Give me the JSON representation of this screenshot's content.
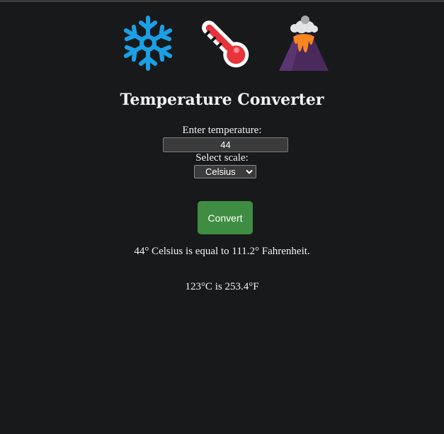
{
  "header": {
    "icons": [
      "snowflake-icon",
      "thermometer-icon",
      "volcano-icon"
    ],
    "title": "Temperature Converter"
  },
  "form": {
    "temperature_label": "Enter temperature:",
    "temperature_value": "44",
    "scale_label": "Select scale:",
    "scale_selected": "Celsius",
    "convert_label": "Convert"
  },
  "results": {
    "conversion_text": "44° Celsius is equal to 111.2° Fahrenheit.",
    "example_text": "123°C is 253.4°F"
  },
  "colors": {
    "background": "#18191b",
    "button": "#3f8d42",
    "snowflake": "#1aa0e6",
    "thermometer": "#e8343b",
    "lava": "#f7861e",
    "mountain": "#4a2a5c"
  }
}
